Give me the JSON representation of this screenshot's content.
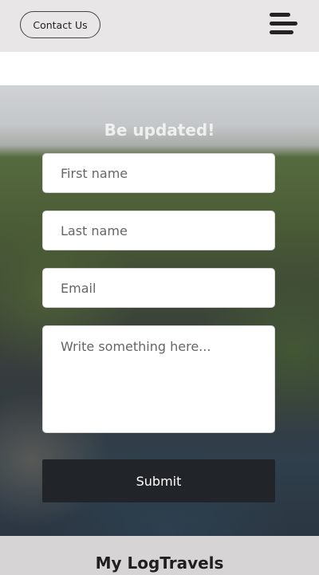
{
  "header": {
    "contact_label": "Contact Us",
    "menu_icon": "hamburger-menu-icon"
  },
  "form": {
    "title": "Be updated!",
    "first_name": {
      "placeholder": "First name",
      "value": ""
    },
    "last_name": {
      "placeholder": "Last name",
      "value": ""
    },
    "email": {
      "placeholder": "Email",
      "value": ""
    },
    "message": {
      "placeholder": "Write something here...",
      "value": ""
    },
    "submit_label": "Submit"
  },
  "footer": {
    "brand": "My LogTravels"
  }
}
